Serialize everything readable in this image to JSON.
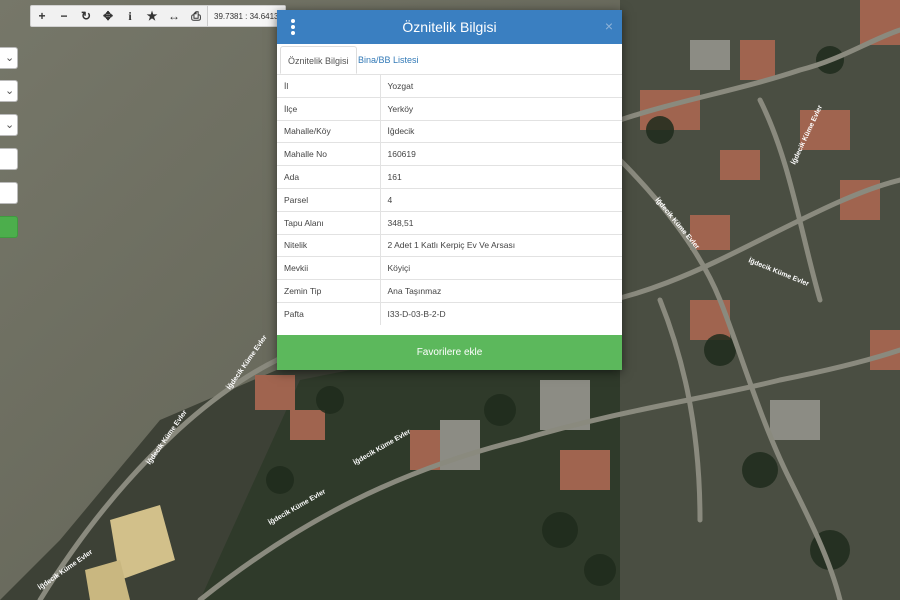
{
  "toolbar": {
    "buttons": [
      {
        "name": "zoom-in-button",
        "glyph": "+"
      },
      {
        "name": "zoom-out-button",
        "glyph": "−"
      },
      {
        "name": "refresh-button",
        "glyph": "↻"
      },
      {
        "name": "pan-button",
        "glyph": "✥"
      },
      {
        "name": "info-button",
        "glyph": "i"
      },
      {
        "name": "favorite-button",
        "glyph": "★"
      },
      {
        "name": "measure-button",
        "glyph": "↔"
      },
      {
        "name": "print-button",
        "glyph": "⎙"
      }
    ],
    "coordinates": "39.7381 : 34.6413"
  },
  "map": {
    "street_labels": [
      "İğdecik Küme Evler",
      "İğdecik Küme Evler",
      "İğdecik Küme Evler",
      "İğdecik Küme Evler",
      "İğdecik Küme Evler",
      "İğdecik Küme Evler",
      "İğdecik Küme Evler",
      "İğdecik Küme Evler"
    ]
  },
  "modal": {
    "title": "Öznitelik Bilgisi",
    "close_glyph": "×",
    "tabs": [
      "Öznitelik Bilgisi",
      "Bina/BB Listesi"
    ],
    "rows": [
      {
        "key": "İl",
        "value": "Yozgat"
      },
      {
        "key": "İlçe",
        "value": "Yerköy"
      },
      {
        "key": "Mahalle/Köy",
        "value": "İğdecik"
      },
      {
        "key": "Mahalle No",
        "value": "160619"
      },
      {
        "key": "Ada",
        "value": "161"
      },
      {
        "key": "Parsel",
        "value": "4"
      },
      {
        "key": "Tapu Alanı",
        "value": "348,51"
      },
      {
        "key": "Nitelik",
        "value": "2 Adet 1 Katlı Kerpiç Ev Ve Arsası"
      },
      {
        "key": "Mevkii",
        "value": "Köyiçi"
      },
      {
        "key": "Zemin Tip",
        "value": "Ana Taşınmaz"
      },
      {
        "key": "Pafta",
        "value": "I33-D-03-B-2-D"
      }
    ],
    "favorite_label": "Favorilere ekle"
  },
  "colors": {
    "header": "#3a7fc1",
    "favorite": "#5cb85c",
    "tab_link": "#337ab7"
  }
}
